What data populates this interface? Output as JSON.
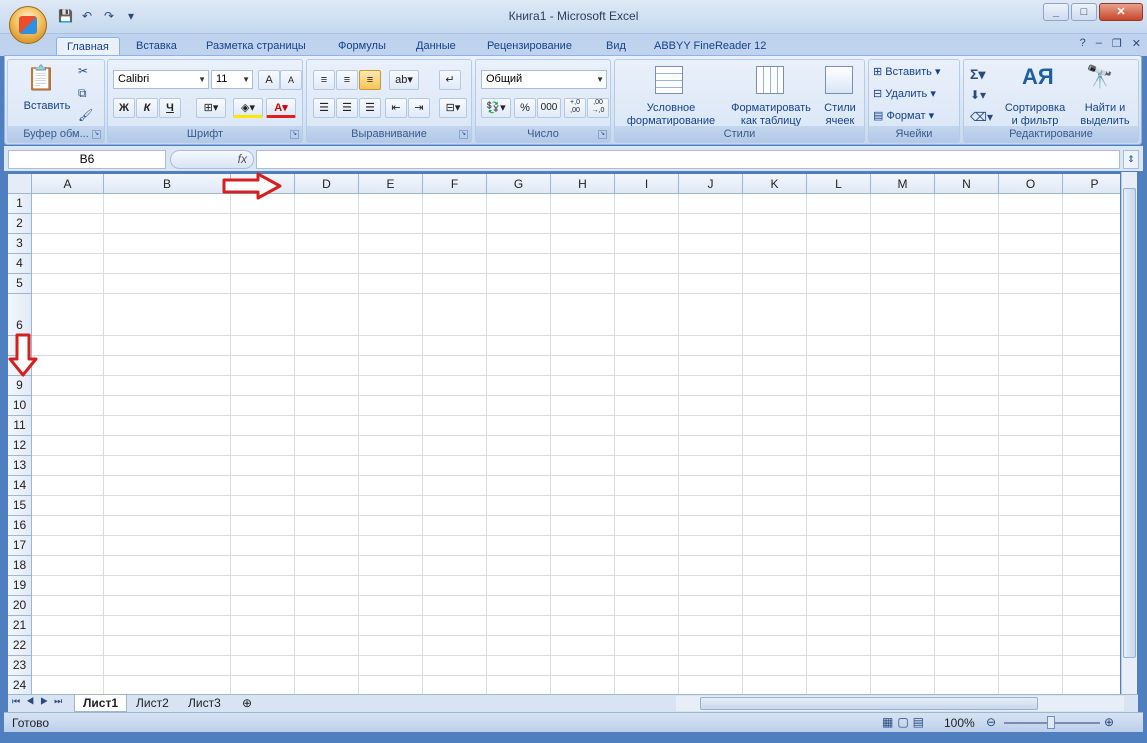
{
  "window": {
    "title": "Книга1 - Microsoft Excel"
  },
  "ribbon_tabs": [
    "Главная",
    "Вставка",
    "Разметка страницы",
    "Формулы",
    "Данные",
    "Рецензирование",
    "Вид",
    "ABBYY FineReader 12"
  ],
  "active_tab": "Главная",
  "groups": {
    "clipboard": {
      "label": "Буфер обм...",
      "paste": "Вставить"
    },
    "font": {
      "label": "Шрифт",
      "font_name": "Calibri",
      "font_size": "11",
      "bold": "Ж",
      "italic": "К",
      "underline": "Ч"
    },
    "alignment": {
      "label": "Выравнивание"
    },
    "number": {
      "label": "Число",
      "format": "Общий",
      "percent": "%",
      "thousands": "000",
      "inc_decimal": "+,0\n,00",
      "dec_decimal": ",00\n→,0"
    },
    "styles": {
      "label": "Стили",
      "conditional": "Условное\nформатирование",
      "as_table": "Форматировать\nкак таблицу",
      "cell_styles": "Стили\nячеек"
    },
    "cells": {
      "label": "Ячейки",
      "insert": "Вставить",
      "delete": "Удалить",
      "format": "Формат"
    },
    "editing": {
      "label": "Редактирование",
      "sort": "Сортировка\nи фильтр",
      "find": "Найти и\nвыделить"
    }
  },
  "formula_bar": {
    "name_box": "B6",
    "fx": "fx",
    "value": ""
  },
  "columns": [
    "A",
    "B",
    "C",
    "D",
    "E",
    "F",
    "G",
    "H",
    "I",
    "J",
    "K",
    "L",
    "M",
    "N",
    "O",
    "P"
  ],
  "rows": [
    "1",
    "2",
    "3",
    "4",
    "5",
    "6",
    "7",
    "8",
    "9",
    "10",
    "11",
    "12",
    "13",
    "14",
    "15",
    "16",
    "17",
    "18",
    "19",
    "20",
    "21",
    "22",
    "23",
    "24"
  ],
  "sheets": [
    "Лист1",
    "Лист2",
    "Лист3"
  ],
  "active_sheet": "Лист1",
  "status": {
    "text": "Готово",
    "zoom": "100%"
  },
  "colors": {
    "annotation_arrow": "#d42020",
    "ribbon_bg": "#d5e3f5",
    "grid_line": "#dadcdd"
  }
}
